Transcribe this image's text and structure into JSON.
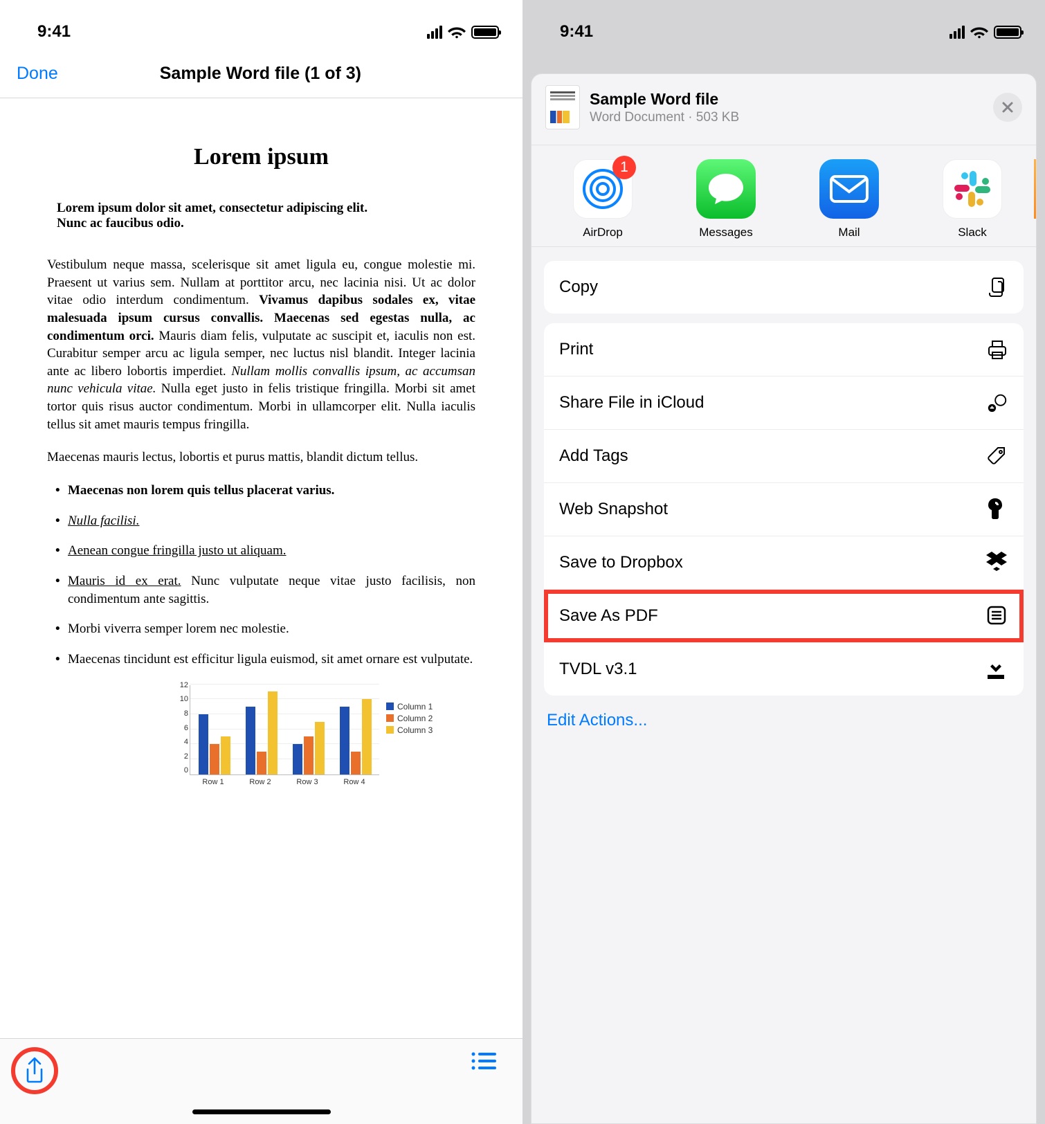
{
  "status": {
    "time": "9:41"
  },
  "left": {
    "nav": {
      "done": "Done",
      "title": "Sample Word file (1 of 3)"
    },
    "doc": {
      "title": "Lorem ipsum",
      "intro_line1": "Lorem ipsum dolor sit amet, consectetur adipiscing elit.",
      "intro_line2": "Nunc ac faucibus odio.",
      "para1_a": "Vestibulum neque massa, scelerisque sit amet ligula eu, congue molestie mi. Praesent ut varius sem. Nullam at porttitor arcu, nec lacinia nisi. Ut ac dolor vitae odio interdum condimentum. ",
      "para1_b_bold": "Vivamus dapibus sodales ex, vitae malesuada ipsum cursus convallis. Maecenas sed egestas nulla, ac condimentum orci.",
      "para1_c": " Mauris diam felis, vulputate ac suscipit et, iaculis non est. Curabitur semper arcu ac ligula semper, nec luctus nisl blandit. Integer lacinia ante ac libero lobortis imperdiet. ",
      "para1_d_italic": "Nullam mollis convallis ipsum, ac accumsan nunc vehicula vitae.",
      "para1_e": " Nulla eget justo in felis tristique fringilla. Morbi sit amet tortor quis risus auctor condimentum. Morbi in ullamcorper elit. Nulla iaculis tellus sit amet mauris tempus fringilla.",
      "para2": "Maecenas mauris lectus, lobortis et purus mattis, blandit dictum tellus.",
      "li1_bold": "Maecenas non lorem quis tellus placerat varius.",
      "li2_italic": "Nulla facilisi.",
      "li3_under": "Aenean congue fringilla justo ut aliquam.",
      "li4_under": "Mauris id ex erat.",
      "li4_rest": " Nunc vulputate neque vitae justo facilisis, non condimentum ante sagittis.",
      "li5": "Morbi viverra semper lorem nec molestie.",
      "li6": "Maecenas tincidunt est efficitur ligula euismod, sit amet ornare est vulputate."
    }
  },
  "chart_data": {
    "type": "bar",
    "categories": [
      "Row 1",
      "Row 2",
      "Row 3",
      "Row 4"
    ],
    "series": [
      {
        "name": "Column 1",
        "values": [
          8,
          9,
          4,
          9
        ],
        "color": "#1f4fb0"
      },
      {
        "name": "Column 2",
        "values": [
          4,
          3,
          5,
          3
        ],
        "color": "#e8702a"
      },
      {
        "name": "Column 3",
        "values": [
          5,
          11,
          7,
          10
        ],
        "color": "#f2c230"
      }
    ],
    "ylim": [
      0,
      12
    ],
    "yticks": [
      0,
      2,
      4,
      6,
      8,
      10,
      12
    ]
  },
  "right": {
    "header": {
      "title": "Sample Word file",
      "subtitle": "Word Document · 503 KB"
    },
    "apps": {
      "airdrop": {
        "label": "AirDrop",
        "badge": "1"
      },
      "messages": {
        "label": "Messages"
      },
      "mail": {
        "label": "Mail"
      },
      "slack": {
        "label": "Slack"
      }
    },
    "actions": {
      "copy": "Copy",
      "print": "Print",
      "share_icloud": "Share File in iCloud",
      "add_tags": "Add Tags",
      "web_snapshot": "Web Snapshot",
      "save_dropbox": "Save to Dropbox",
      "save_pdf": "Save As PDF",
      "tvdl": "TVDL v3.1"
    },
    "edit_actions": "Edit Actions..."
  }
}
